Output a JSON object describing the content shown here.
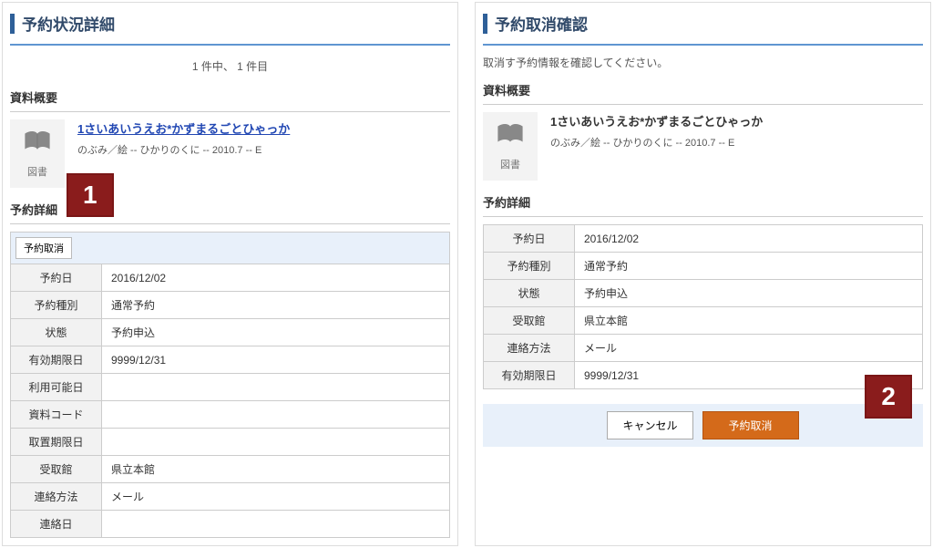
{
  "left": {
    "title": "予約状況詳細",
    "pager": "1 件中、 1 件目",
    "section_material": "資料概要",
    "material": {
      "thumb_label": "図書",
      "title": "1さいあいうえお*かずまるごとひゃっか",
      "sub": "のぶみ／絵 -- ひかりのくに -- 2010.7 -- E"
    },
    "section_detail": "予約詳細",
    "cancel_btn": "予約取消",
    "callout1": "1",
    "rows": [
      {
        "label": "予約日",
        "value": "2016/12/02"
      },
      {
        "label": "予約種別",
        "value": "通常予約"
      },
      {
        "label": "状態",
        "value": "予約申込"
      },
      {
        "label": "有効期限日",
        "value": "9999/12/31"
      },
      {
        "label": "利用可能日",
        "value": ""
      },
      {
        "label": "資料コード",
        "value": ""
      },
      {
        "label": "取置期限日",
        "value": ""
      },
      {
        "label": "受取館",
        "value": "県立本館"
      },
      {
        "label": "連絡方法",
        "value": "メール"
      },
      {
        "label": "連絡日",
        "value": ""
      }
    ]
  },
  "right": {
    "title": "予約取消確認",
    "note": "取消す予約情報を確認してください。",
    "section_material": "資料概要",
    "material": {
      "thumb_label": "図書",
      "title": "1さいあいうえお*かずまるごとひゃっか",
      "sub": "のぶみ／絵 -- ひかりのくに -- 2010.7 -- E"
    },
    "section_detail": "予約詳細",
    "rows": [
      {
        "label": "予約日",
        "value": "2016/12/02"
      },
      {
        "label": "予約種別",
        "value": "通常予約"
      },
      {
        "label": "状態",
        "value": "予約申込"
      },
      {
        "label": "受取館",
        "value": "県立本館"
      },
      {
        "label": "連絡方法",
        "value": "メール"
      },
      {
        "label": "有効期限日",
        "value": "9999/12/31"
      }
    ],
    "btn_cancel": "キャンセル",
    "btn_submit": "予約取消",
    "callout2": "2"
  }
}
